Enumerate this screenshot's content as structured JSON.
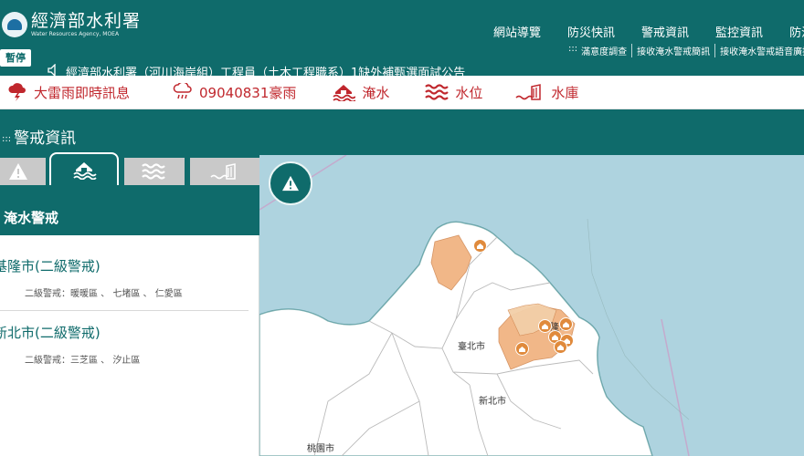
{
  "header": {
    "logo_cn": "經濟部水利署",
    "logo_en": "Water Resources Agency, MOEA",
    "nav": [
      "網站導覽",
      "防災快訊",
      "警戒資訊",
      "監控資訊",
      "防汛專"
    ],
    "subnav_marker": ":::",
    "subnav": [
      "滿意度調查",
      "接收淹水警戒簡訊",
      "接收淹水警戒語音廣播"
    ],
    "pause_label": "暫停",
    "marquee": "經濟部水利署（河川海岸組）工程員（土木工程職系）1缺外補甄選面試公告"
  },
  "alerts": [
    {
      "label": "大雷雨即時訊息",
      "icon": "thunderstorm-icon"
    },
    {
      "label": "09040831豪雨",
      "icon": "heavy-rain-icon"
    },
    {
      "label": "淹水",
      "icon": "flood-icon"
    },
    {
      "label": "水位",
      "icon": "water-level-icon"
    },
    {
      "label": "水庫",
      "icon": "reservoir-icon"
    }
  ],
  "section": {
    "dots": ":::",
    "title": "警戒資訊"
  },
  "panel": {
    "tabs": [
      {
        "name": "warning",
        "icon": "warning-icon"
      },
      {
        "name": "flood",
        "icon": "flood-icon",
        "active": true
      },
      {
        "name": "water-level",
        "icon": "water-level-icon"
      },
      {
        "name": "reservoir",
        "icon": "reservoir-icon"
      }
    ],
    "heading": "淹水警戒",
    "areas": [
      {
        "title": "基隆市(二級警戒)",
        "detail": "二級警戒：暖暖區 、 七堵區 、 仁愛區"
      },
      {
        "title": "新北市(二級警戒)",
        "detail": "二級警戒：三芝區 、 汐止區"
      }
    ]
  },
  "map": {
    "labels": [
      "基隆市",
      "臺北市",
      "新北市",
      "桃園市"
    ],
    "colors": {
      "sea": "#aed3df",
      "land": "#ffffff",
      "warn_fill": "#f0b07c",
      "warn_light": "#f3cfa8",
      "pin": "#e08a3c",
      "coast": "#0f6b6b"
    }
  }
}
